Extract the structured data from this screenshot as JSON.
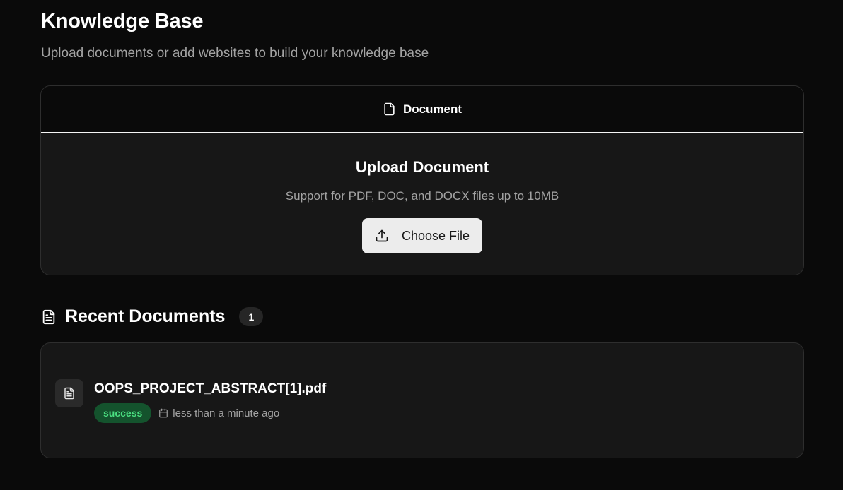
{
  "header": {
    "title": "Knowledge Base",
    "subtitle": "Upload documents or add websites to build your knowledge base"
  },
  "tabs": [
    {
      "label": "Document",
      "icon": "file-icon",
      "active": true
    }
  ],
  "upload": {
    "title": "Upload Document",
    "description": "Support for PDF, DOC, and DOCX files up to 10MB",
    "button_label": "Choose File",
    "button_icon": "upload-icon"
  },
  "recent": {
    "title": "Recent Documents",
    "icon": "file-text-icon",
    "count": "1",
    "documents": [
      {
        "name": "OOPS_PROJECT_ABSTRACT[1].pdf",
        "status": "success",
        "time": "less than a minute ago"
      }
    ]
  },
  "colors": {
    "background": "#0a0a0a",
    "card": "#171717",
    "success_bg": "#14532d",
    "success_text": "#4ade80",
    "button_bg": "#ececec"
  }
}
